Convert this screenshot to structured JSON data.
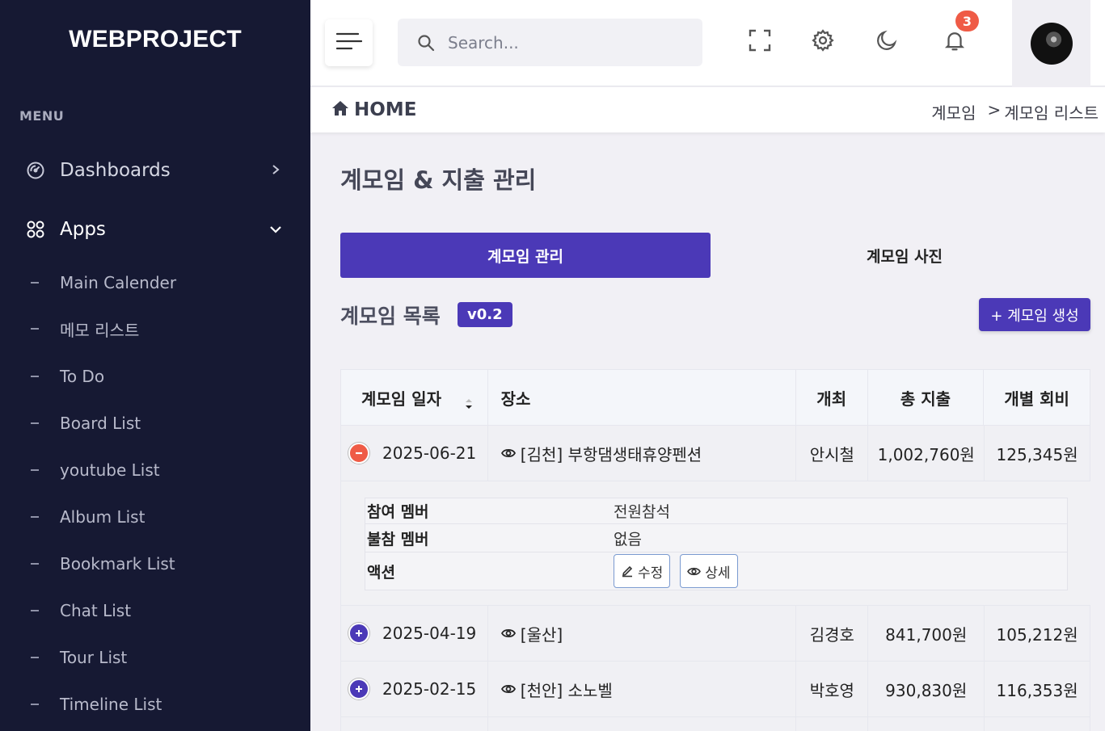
{
  "brand": "WEBPROJECT",
  "sidebar": {
    "menu_label": "MENU",
    "dashboards": "Dashboards",
    "apps": "Apps",
    "items": [
      "Main Calender",
      "메모 리스트",
      "To Do",
      "Board List",
      "youtube List",
      "Album List",
      "Bookmark List",
      "Chat List",
      "Tour List",
      "Timeline List"
    ]
  },
  "header": {
    "search_placeholder": "Search...",
    "notification_count": "3"
  },
  "breadcrumb": {
    "home": "HOME",
    "path1": "계모임",
    "sep": ">",
    "path2": "계모임 리스트"
  },
  "page": {
    "title": "계모임 & 지출 관리",
    "tab_active": "계모임 관리",
    "tab_inactive": "계모임 사진",
    "list_title": "계모임 목록",
    "version": "v0.2",
    "create_button": "+ 계모임 생성"
  },
  "table": {
    "headers": [
      "계모임 일자",
      "장소",
      "개최",
      "총 지출",
      "개별 회비"
    ],
    "rows": [
      {
        "date": "2025-06-21",
        "place": "[김천] 부항댐생태휴양펜션",
        "host": "안시철",
        "total": "1,002,760원",
        "each": "125,345원",
        "expanded": true
      },
      {
        "date": "2025-04-19",
        "place": "[울산]",
        "host": "김경호",
        "total": "841,700원",
        "each": "105,212원",
        "expanded": false
      },
      {
        "date": "2025-02-15",
        "place": "[천안] 소노벨",
        "host": "박호영",
        "total": "930,830원",
        "each": "116,353원",
        "expanded": false
      }
    ],
    "detail": {
      "members_label": "참여 멤버",
      "members_value": "전원참석",
      "absent_label": "불참 멤버",
      "absent_value": "없음",
      "action_label": "액션",
      "edit_button": "수정",
      "view_button": "상세"
    }
  },
  "colors": {
    "sidebar_bg": "#161933",
    "accent": "#4b39b7",
    "badge": "#ef5b46"
  }
}
